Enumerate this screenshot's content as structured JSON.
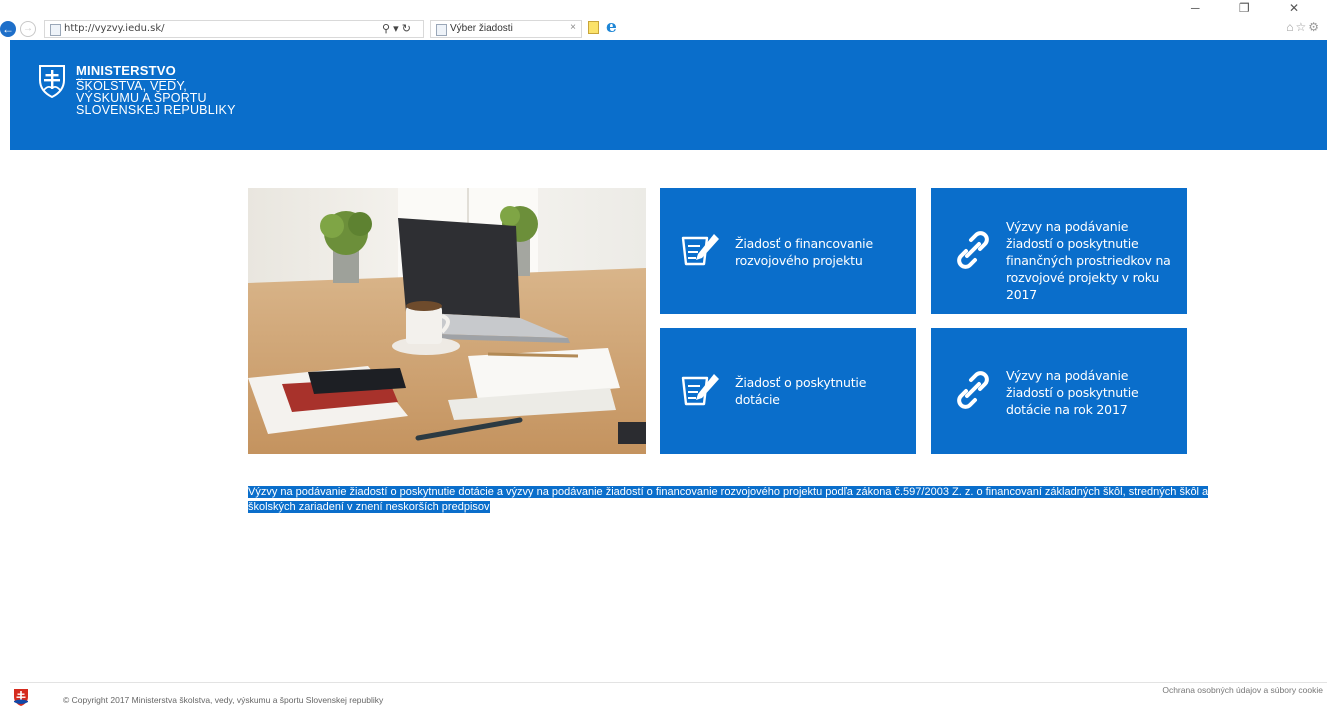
{
  "browser": {
    "url": "http://vyzvy.iedu.sk/",
    "tab_title": "Výber žiadosti",
    "tab_close": "×",
    "addr_tools": "⚲ ▾ ↻",
    "back_glyph": "←",
    "forward_glyph": "→",
    "window_controls": "─ ❐ ✕",
    "right_tools": "⌂☆⚙"
  },
  "header": {
    "title_line1": "MINISTERSTVO",
    "title_line2": "ŠKOLSTVA, VEDY,",
    "title_line3": "VÝSKUMU A ŠPORTU",
    "title_line4": "SLOVENSKEJ REPUBLIKY",
    "brand_color": "#0a6ecb"
  },
  "tiles": [
    {
      "label": "Žiadosť o financovanie rozvojového projektu",
      "icon": "form-edit-icon"
    },
    {
      "label": "Výzvy na podávanie žiadostí o poskytnutie finančných prostriedkov na rozvojové projekty v roku 2017",
      "icon": "link-icon"
    },
    {
      "label": "Žiadosť o poskytnutie dotácie",
      "icon": "form-edit-icon"
    },
    {
      "label": "Výzvy na podávanie žiadostí o poskytnutie dotácie na rok 2017",
      "icon": "link-icon"
    }
  ],
  "description": "Výzvy na podávanie žiadostí o poskytnutie dotácie a výzvy na podávanie žiadostí o financovanie rozvojového projektu podľa zákona č.597/2003 Z. z. o financovaní základných škôl, stredných škôl a školských zariadení v znení neskorších predpisov",
  "footer": {
    "copyright": "© Copyright 2017 Ministerstva školstva, vedy, výskumu a športu Slovenskej republiky",
    "privacy_link": "Ochrana osobných údajov a súbory cookie"
  }
}
